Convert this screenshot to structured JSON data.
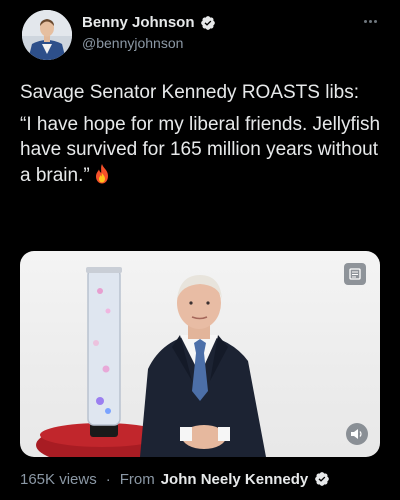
{
  "author": {
    "display_name": "Benny Johnson",
    "handle": "@bennyjohnson",
    "verified": true
  },
  "tweet": {
    "line1": "Savage Senator Kennedy ROASTS libs:",
    "quote": "“I have hope for my liberal friends. Jellyfish have survived for 165 million years without a brain.”",
    "emoji": "fire-emoji"
  },
  "footer": {
    "views": "165K views",
    "separator": "·",
    "from_label": "From",
    "source_name": "John Neely Kennedy",
    "source_verified": true
  },
  "icons": {
    "more": "more-icon",
    "media_top": "document-icon",
    "media_sound": "sound-icon"
  },
  "colors": {
    "background": "#000000",
    "text": "#e7e9ea",
    "secondary": "#8b98a5",
    "verified_blue": "#1d9bf0"
  }
}
